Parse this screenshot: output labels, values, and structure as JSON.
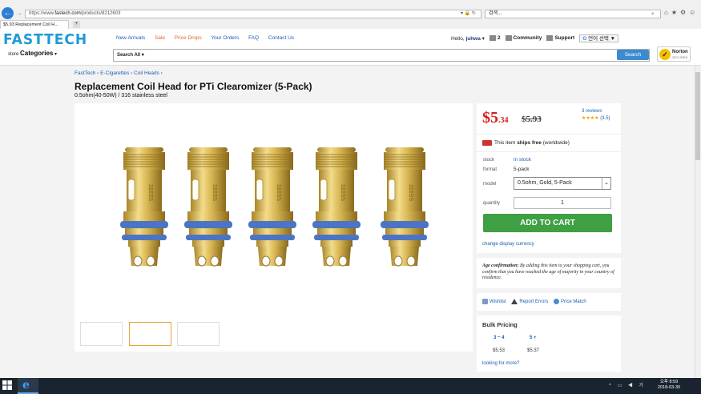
{
  "browser": {
    "url_prefix": "https://www.",
    "url_host": "fastech.com",
    "url_path": "/products/8212603",
    "search_value": "검색...",
    "tab_title": "$5.93 Replacement Coil H..."
  },
  "header": {
    "logo": "FASTTECH",
    "nav": [
      "New Arrivals",
      "Sale",
      "Price Drops",
      "Your Orders",
      "FAQ",
      "Contact Us"
    ],
    "hello": "Hello,",
    "username": "juhwa",
    "cart_count": "2",
    "community": "Community",
    "support": "Support",
    "lang": "언어 선택",
    "store_label": "store",
    "categories": "Categories",
    "search_all": "Search All",
    "search_button": "Search",
    "norton": "Norton",
    "norton_sub": "SECURED"
  },
  "breadcrumb": "FastTech › E-Cigarettes › Coil Heads ›",
  "product": {
    "title": "Replacement Coil Head for PTi Clearomizer (5-Pack)",
    "subtitle": "0.5ohm(40-50W) / 316 stainless steel",
    "price_dollars": "$5",
    "price_cents": ".34",
    "old_price": "$5.93",
    "reviews": "3 reviews",
    "stars": "★★★★",
    "rating": "(3.5)",
    "ship_pre": "This item",
    "ship_bold": "ships free",
    "ship_post": "(worldwide)",
    "stock_label": "stock",
    "stock_value": "in stock",
    "format_label": "format",
    "format_value": "5-pack",
    "model_label": "model",
    "model_value": "0.5ohm, Gold, 5-Pack",
    "quantity_label": "quantity",
    "quantity_value": "1",
    "add_to_cart": "ADD TO CART",
    "currency_link": "change display currency",
    "coil_engraving": "316SS"
  },
  "age": {
    "bold": "Age confirmation:",
    "text": "By adding this item to your shopping cart, you confirm that you have reached the age of majority in your country of residence."
  },
  "links": {
    "wishlist": "Wishlist",
    "report": "Report Errors",
    "price_match": "Price Match"
  },
  "bulk": {
    "title": "Bulk Pricing",
    "tiers": [
      "3 ~ 4",
      "5 +"
    ],
    "prices": [
      "$5.53",
      "$5.37"
    ],
    "more": "looking for more?"
  },
  "taskbar": {
    "time": "오후 8:59",
    "date": "2018-03-30"
  },
  "colors": {
    "price_red": "#d42020",
    "cart_green": "#3ea043",
    "link_blue": "#1a5fb4",
    "logo_blue": "#1f9ad6"
  }
}
